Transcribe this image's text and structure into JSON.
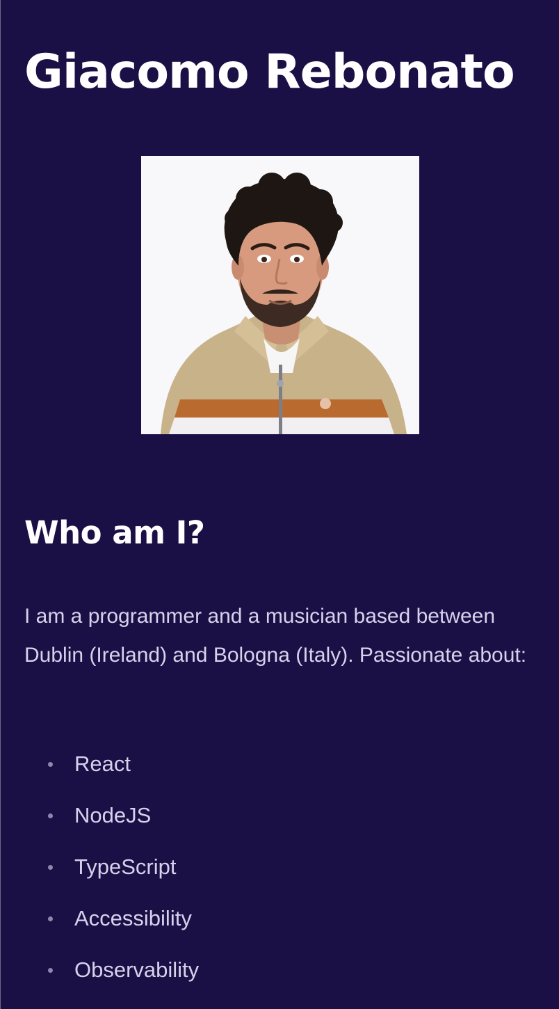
{
  "header": {
    "title": "Giacomo Rebonato"
  },
  "profile_photo": {
    "subject": "portrait photo of a smiling man with curly dark hair and beard, wearing a beige jacket with orange and white stripes"
  },
  "about": {
    "heading": "Who am I?",
    "intro": "I am a programmer and a musician based between Dublin (Ireland) and Bologna (Italy). Passionate about:",
    "interests": [
      "React",
      "NodeJS",
      "TypeScript",
      "Accessibility",
      "Observability"
    ]
  },
  "colors": {
    "background": "#1b1045",
    "heading_text": "#ffffff",
    "body_text": "#d7d2ec",
    "bullet": "#8d87ad"
  }
}
